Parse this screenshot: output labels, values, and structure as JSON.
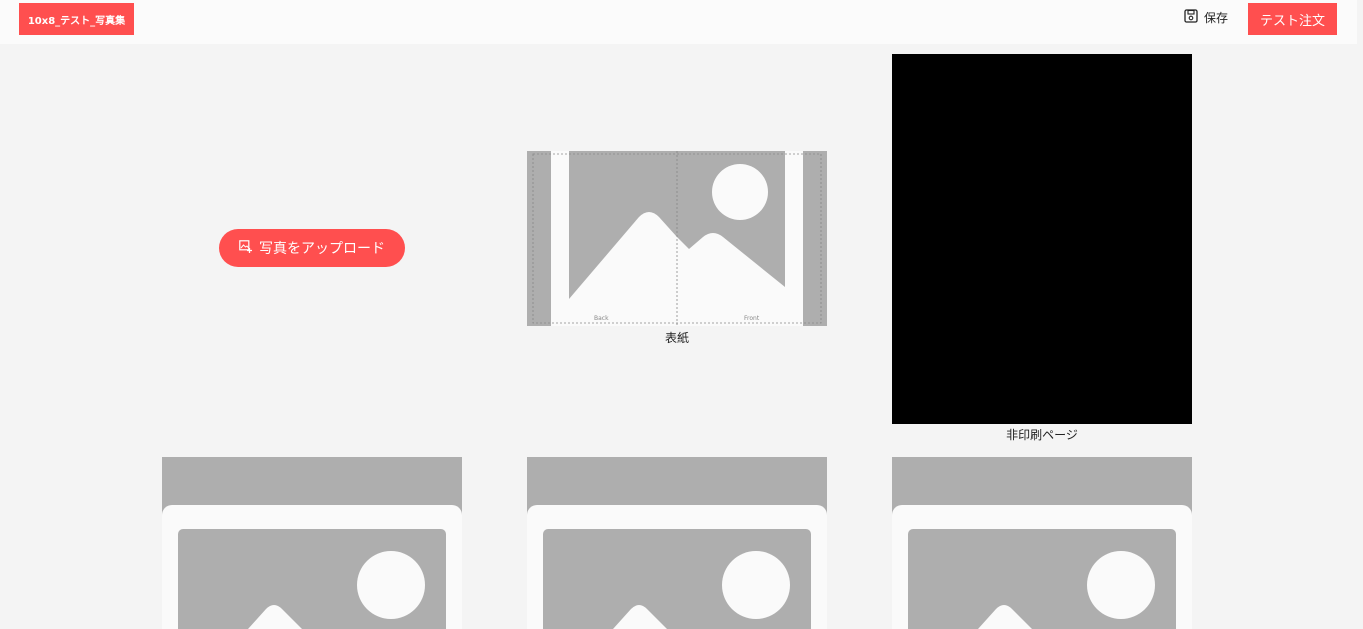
{
  "header": {
    "title": "10x8_テスト_写真集",
    "save_label": "保存",
    "order_label": "テスト注文"
  },
  "upload": {
    "label": "写真をアップロード"
  },
  "cover": {
    "label": "表紙",
    "back_label": "Back",
    "front_label": "Front"
  },
  "nonprint": {
    "label": "非印刷ページ"
  },
  "colors": {
    "accent": "#ff4f4f",
    "placeholder": "#aeaeae",
    "placeholder_light": "#fafafa"
  },
  "icons": {
    "save": "floppy-disk-icon",
    "upload": "image-add-icon",
    "placeholder": "image-placeholder-icon"
  }
}
